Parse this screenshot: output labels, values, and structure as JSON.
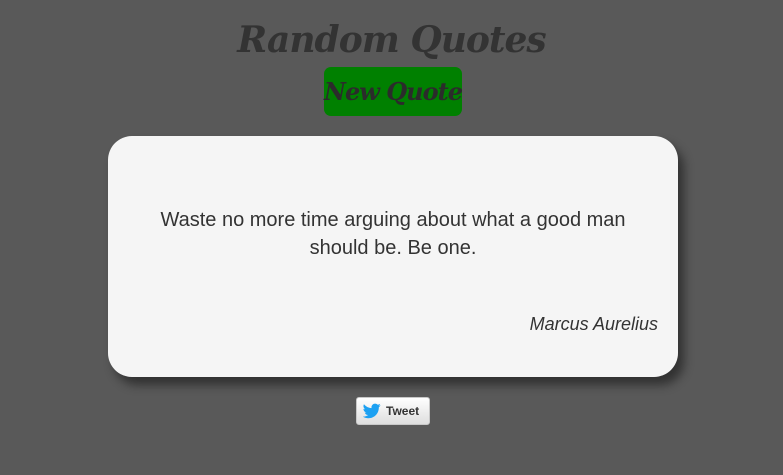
{
  "header": {
    "title": "Random Quotes",
    "new_quote_label": "New Quote"
  },
  "quote": {
    "text": "Waste no more time arguing about what a good man should be. Be one.",
    "author": "Marcus Aurelius"
  },
  "share": {
    "tweet_label": "Tweet",
    "icon": "twitter-bird-icon"
  },
  "colors": {
    "background": "#595959",
    "button": "#008000",
    "card": "#f5f5f5",
    "text": "#333333",
    "twitter_blue": "#1da1f2"
  }
}
